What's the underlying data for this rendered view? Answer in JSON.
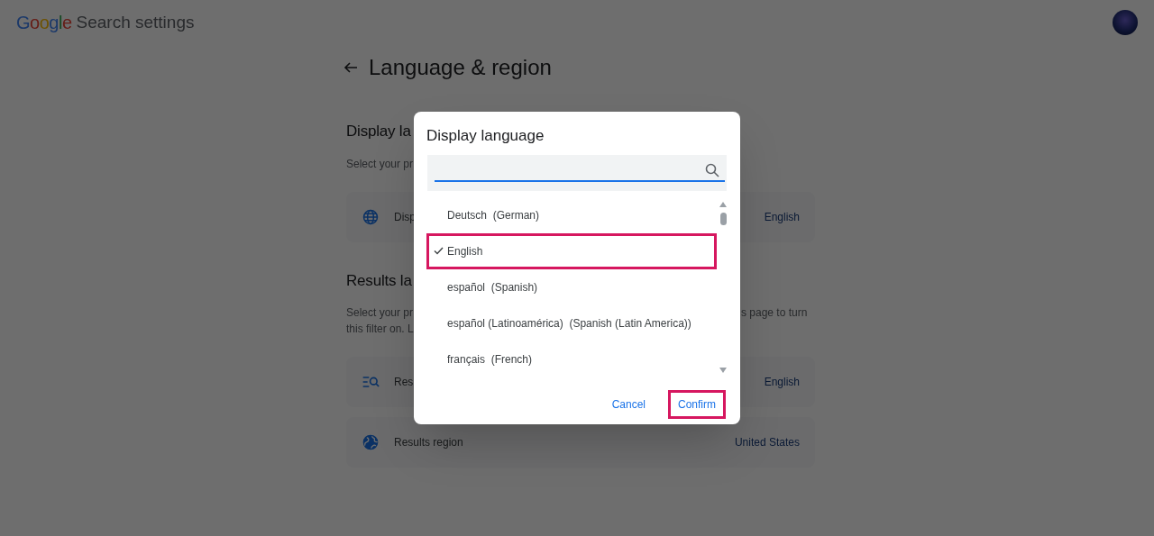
{
  "header": {
    "logo": "Google",
    "title": "Search settings"
  },
  "page": {
    "title": "Language & region",
    "sections": [
      {
        "heading": "Display la",
        "description": [
          "Select your pr"
        ],
        "rows": [
          {
            "label": "Disp",
            "value": "English"
          }
        ]
      },
      {
        "heading": "Results la",
        "description": [
          "Select your pr",
          "this filter on. L"
        ],
        "description_right": "s page to turn",
        "rows": [
          {
            "label": "Res",
            "value": "English"
          },
          {
            "label": "Results region",
            "value": "United States"
          }
        ]
      }
    ]
  },
  "dialog": {
    "title": "Display language",
    "languages": [
      {
        "name": "Deutsch",
        "english": "(German)",
        "selected": false
      },
      {
        "name": "English",
        "selected": true
      },
      {
        "name": "español",
        "english": "(Spanish)",
        "selected": false
      },
      {
        "name": "español (Latinoamérica)",
        "english": "(Spanish (Latin America))",
        "selected": false
      },
      {
        "name": "français",
        "english": "(French)",
        "selected": false
      }
    ],
    "buttons": [
      {
        "label": "Cancel",
        "highlighted": false
      },
      {
        "label": "Confirm",
        "highlighted": true
      }
    ]
  }
}
